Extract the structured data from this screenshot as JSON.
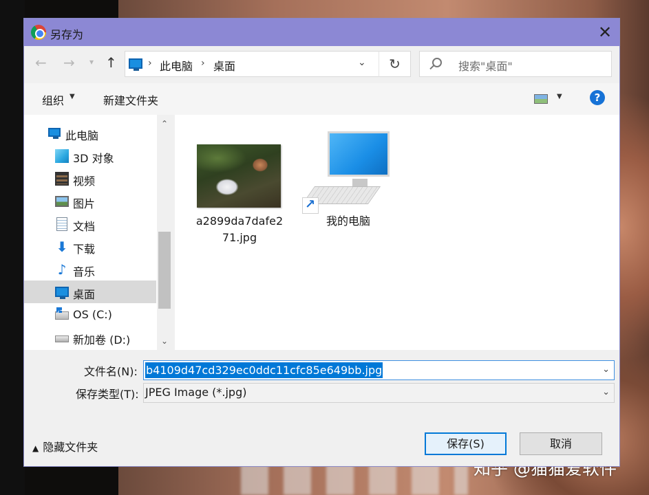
{
  "window": {
    "title": "另存为"
  },
  "address": {
    "crumbs": [
      "此电脑",
      "桌面"
    ],
    "search_placeholder": "搜索\"桌面\""
  },
  "toolbar": {
    "organize_label": "组织",
    "new_folder_label": "新建文件夹",
    "help_label": "?"
  },
  "nav_pane": {
    "items": [
      {
        "label": "此电脑",
        "icon": "computer-icon"
      },
      {
        "label": "3D 对象",
        "icon": "cube-3d-icon"
      },
      {
        "label": "视频",
        "icon": "video-icon"
      },
      {
        "label": "图片",
        "icon": "picture-icon"
      },
      {
        "label": "文档",
        "icon": "document-icon"
      },
      {
        "label": "下载",
        "icon": "download-arrow-icon"
      },
      {
        "label": "音乐",
        "icon": "music-note-icon"
      },
      {
        "label": "桌面",
        "icon": "desktop-icon",
        "selected": true
      },
      {
        "label": "OS (C:)",
        "icon": "windows-drive-icon"
      },
      {
        "label": "新加卷 (D:)",
        "icon": "drive-icon"
      }
    ]
  },
  "files": [
    {
      "label_line1": "a2899da7dafe2",
      "label_line2": "71.jpg",
      "icon": "image-thumbnail"
    },
    {
      "label_line1": "我的电脑",
      "icon": "computer-shortcut-icon"
    }
  ],
  "form": {
    "filename_label": "文件名(N):",
    "filename_value": "b4109d47cd329ec0ddc11cfc85e649bb.jpg",
    "filetype_label": "保存类型(T):",
    "filetype_value": "JPEG Image (*.jpg)"
  },
  "footer": {
    "hide_folders_label": "隐藏文件夹",
    "save_label": "保存(S)",
    "cancel_label": "取消"
  },
  "watermark": "知乎 @猫猫爱软件",
  "colors": {
    "titlebar": "#8c88d4",
    "selection": "#0078d7",
    "nav_selected": "#d9d9d9"
  }
}
